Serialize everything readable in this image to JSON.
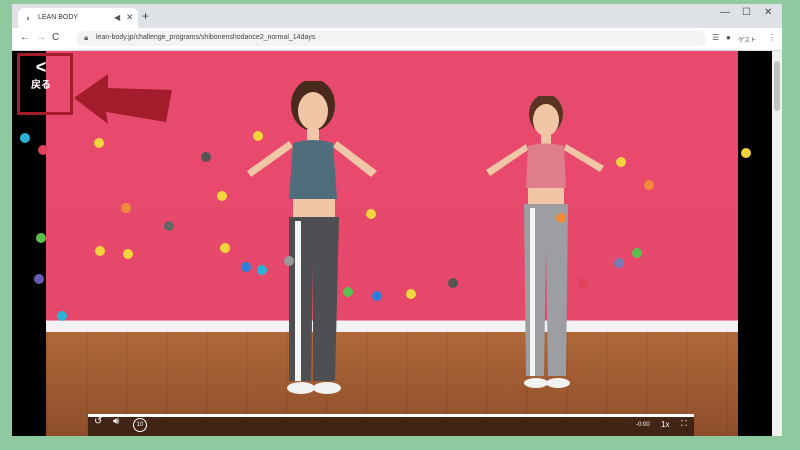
{
  "browser": {
    "tab_title": "LEAN BODY",
    "new_tab": "+",
    "url": "lean-body.jp/challenge_programs/shibonenshodance2_normal_14days",
    "profile_label": "ゲスト",
    "controls": {
      "minimize": "—",
      "maximize": "☐",
      "close": "✕"
    },
    "nav": {
      "back": "←",
      "forward": "→",
      "reload": "C"
    }
  },
  "page": {
    "back_button": {
      "chevron": "<",
      "label": "戻る"
    }
  },
  "player": {
    "time_remaining": "-0:00",
    "speed": "1x",
    "skip_label": "10",
    "progress": 1.0
  },
  "colors": {
    "highlight": "#a31c2b",
    "stage_pink": "#e94a6e",
    "page_bg": "#8ec9a0"
  },
  "icons": {
    "replay": "replay-icon",
    "volume": "volume-icon",
    "skip": "skip-10-icon",
    "fullscreen": "fullscreen-icon",
    "lock": "lock-icon",
    "menu": "menu-dots-icon",
    "reading_list": "reading-list-icon",
    "account": "account-icon"
  }
}
